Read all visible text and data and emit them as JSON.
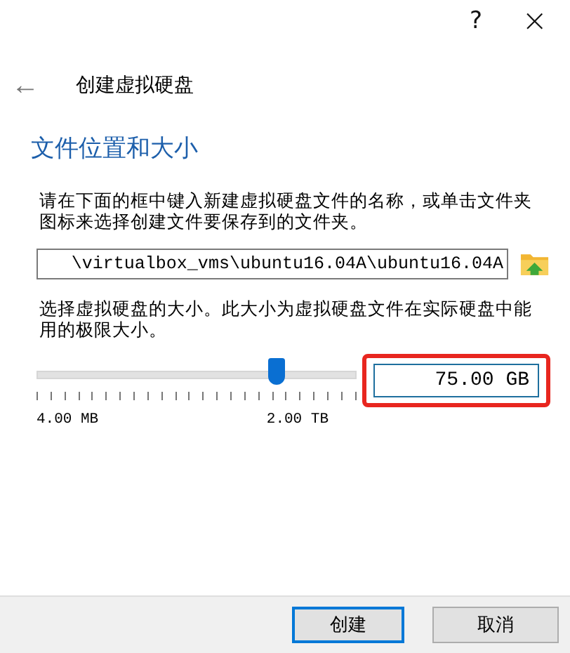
{
  "window": {
    "help": "?",
    "close": "×"
  },
  "header": {
    "back": "←",
    "title": "创建虚拟硬盘"
  },
  "heading": "文件位置和大小",
  "location_hint": "请在下面的框中键入新建虚拟硬盘文件的名称，或单击文件夹图标来选择创建文件要保存到的文件夹。",
  "path_field": {
    "value": "\\virtualbox_vms\\ubuntu16.04A\\ubuntu16.04A"
  },
  "size_hint": "选择虚拟硬盘的大小。此大小为虚拟硬盘文件在实际硬盘中能用的极限大小。",
  "size_slider": {
    "level": 0.75,
    "min_label": "4.00 MB",
    "max_label": "2.00 TB"
  },
  "size_field": {
    "value": "75.00 GB",
    "highlighted": true
  },
  "buttons": [
    {
      "label": "创建",
      "kind": "default"
    },
    {
      "label": "取消",
      "kind": "normal"
    }
  ]
}
